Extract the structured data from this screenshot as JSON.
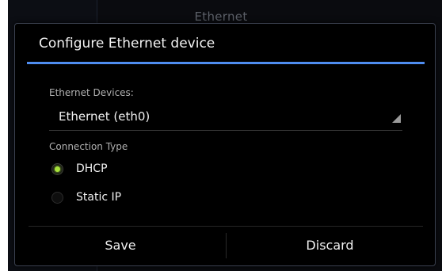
{
  "background": {
    "title": "Ethernet"
  },
  "dialog": {
    "title": "Configure Ethernet device",
    "devices_label": "Ethernet Devices:",
    "selected_device": "Ethernet (eth0)",
    "connection_type_label": "Connection Type",
    "options": [
      {
        "label": "DHCP",
        "checked": true
      },
      {
        "label": "Static IP",
        "checked": false
      }
    ],
    "save_label": "Save",
    "discard_label": "Discard"
  },
  "colors": {
    "accent": "#4f8df0",
    "radio_checked": "#a7e23b"
  }
}
